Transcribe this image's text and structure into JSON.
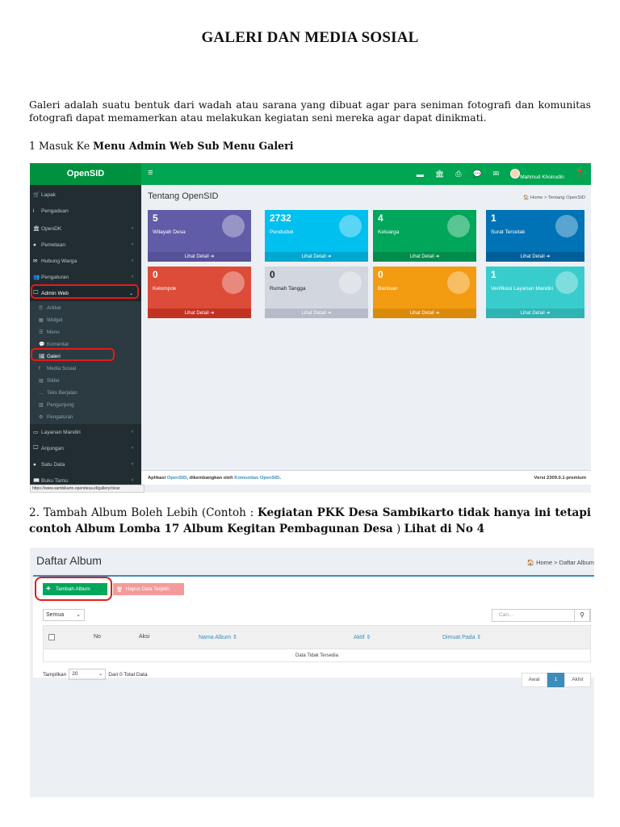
{
  "doc": {
    "title": "GALERI DAN MEDIA SOSIAL",
    "intro": "Galeri adalah suatu bentuk dari wadah atau sarana yang dibuat agar para seniman fotografi dan komunitas fotografi dapat memamerkan atau melakukan kegiatan seni mereka agar dapat dinikmati.",
    "step1_prefix": "1 Masuk Ke ",
    "step1_bold": "Menu Admin Web Sub Menu Galeri",
    "step2_prefix": "2. Tambah Album Boleh Lebih (Contoh : ",
    "step2_bold1": "Kegiatan PKK Desa Sambikarto tidak hanya ini tetapi contoh Album Lomba 17 Album Kegitan Pembagunan Desa",
    "step2_mid": " ) ",
    "step2_bold2": "Lihat di No 4"
  },
  "shot1": {
    "brand": "OpenSID",
    "hamburger": "≡",
    "user_name": "Mahmud Khoirudin",
    "page_title": "Tentang OpenSID",
    "breadcrumb": "🏠 Home  >  Tentang OpenSID",
    "sidebar": [
      {
        "icon": "🛒",
        "label": "Lapak"
      },
      {
        "icon": "i",
        "label": "Pengaduan"
      },
      {
        "icon": "🏛",
        "label": "OpenDK"
      },
      {
        "icon": "●",
        "label": "Pemetaan"
      },
      {
        "icon": "✉",
        "label": "Hubung Warga"
      },
      {
        "icon": "👥",
        "label": "Pengaturan"
      },
      {
        "icon": "🖵",
        "label": "Admin Web"
      }
    ],
    "submenu": [
      {
        "icon": "🗎",
        "label": "Artikel"
      },
      {
        "icon": "▦",
        "label": "Widget"
      },
      {
        "icon": "☰",
        "label": "Menu"
      },
      {
        "icon": "💬",
        "label": "Komentar"
      },
      {
        "icon": "🖼",
        "label": "Galeri"
      },
      {
        "icon": "f",
        "label": "Media Sosial"
      },
      {
        "icon": "▤",
        "label": "Slider"
      },
      {
        "icon": "…",
        "label": "Teks Berjalan"
      },
      {
        "icon": "▥",
        "label": "Pengunjung"
      },
      {
        "icon": "⚙",
        "label": "Pengaturan"
      }
    ],
    "sidebar_bottom": [
      {
        "icon": "▭",
        "label": "Layanan Mandiri"
      },
      {
        "icon": "🖵",
        "label": "Anjungan"
      },
      {
        "icon": "●",
        "label": "Satu Data"
      },
      {
        "icon": "📖",
        "label": "Buku Tamu"
      }
    ],
    "boxes": [
      {
        "num": "5",
        "label": "Wilayah Desa",
        "footer": "Lihat Detail ➜",
        "color": "#605ca8",
        "foot": "#56529a"
      },
      {
        "num": "2732",
        "label": "Penduduk",
        "footer": "Lihat Detail ➜",
        "color": "#00c0ef",
        "foot": "#00a7d0"
      },
      {
        "num": "4",
        "label": "Keluarga",
        "footer": "Lihat Detail ➜",
        "color": "#00a65a",
        "foot": "#008d4c"
      },
      {
        "num": "1",
        "label": "Surat Tercetak",
        "footer": "Lihat Detail ➜",
        "color": "#0073b7",
        "foot": "#005f99"
      },
      {
        "num": "0",
        "label": "Kelompok",
        "footer": "Lihat Detail ➜",
        "color": "#dd4b39",
        "foot": "#c23321"
      },
      {
        "num": "0",
        "label": "Rumah Tangga",
        "footer": "Lihat Detail ➜",
        "color": "#d2d6de",
        "foot": "#b5bbc8"
      },
      {
        "num": "0",
        "label": "Bantuan",
        "footer": "Lihat Detail ➜",
        "color": "#f39c12",
        "foot": "#db8b0b"
      },
      {
        "num": "1",
        "label": "Verifikasi Layanan Mandiri",
        "footer": "Lihat Detail ➜",
        "color": "#39cccc",
        "foot": "#2fb3b3"
      }
    ],
    "footer_app": "Aplikasi ",
    "footer_link1": "OpenSID",
    "footer_mid": ", dikembangkan oleh ",
    "footer_link2": "Komunitas OpenSID",
    "footer_end": ".",
    "version": "Versi 2309.0.1-premium",
    "status_url": "https://www.sambikarto.opendesa.id/gallery/clear"
  },
  "shot2": {
    "title": "Daftar Album",
    "breadcrumb": "🏠  Home  >  Daftar Album",
    "add_button": "Tambah Album",
    "delete_button": "Hapus Data Terpilih",
    "filter_value": "Semua",
    "search_placeholder": "Cari...",
    "columns": {
      "no": "No",
      "aksi": "Aksi",
      "nama": "Nama Album ⇕",
      "aktif": "Aktif ⇕",
      "dimuat": "Dimuat Pada ⇕"
    },
    "empty_text": "Data Tidak Tersedia",
    "show_label": "Tampilkan",
    "show_value": "20",
    "total_text": "Dari 0 Total Data",
    "pager": {
      "first": "Awal",
      "current": "1",
      "last": "Akhir"
    }
  }
}
